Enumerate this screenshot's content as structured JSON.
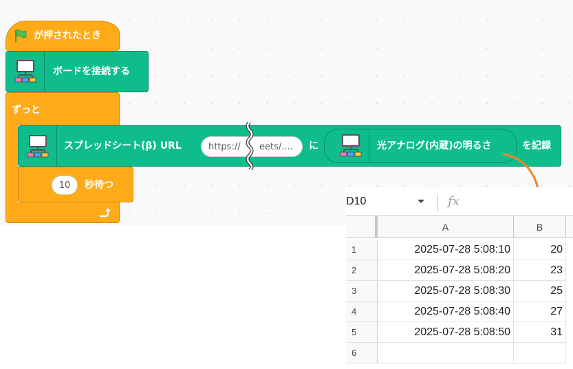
{
  "blocks": {
    "hat": {
      "label": "が押されたとき",
      "icon": "green-flag-icon"
    },
    "connect": {
      "label": "ボードを接続する",
      "icon": "board-icon"
    },
    "forever": {
      "label": "ずっと",
      "loop_icon": "loop-arrow-icon"
    },
    "record": {
      "label_before": "スプレッドシート(β) URL",
      "url_start": "https://",
      "url_end": "eets/....",
      "to_label": "に",
      "reporter_label": "光アナログ(内蔵)の明るさ",
      "action_label": "を記録"
    },
    "wait": {
      "value": "10",
      "label": "秒待つ"
    }
  },
  "spreadsheet": {
    "namebox": "D10",
    "fx": "fx",
    "columns": [
      "A",
      "B"
    ],
    "rows": [
      {
        "num": "1",
        "a": "2025-07-28 5:08:10",
        "b": "20"
      },
      {
        "num": "2",
        "a": "2025-07-28 5:08:20",
        "b": "23"
      },
      {
        "num": "3",
        "a": "2025-07-28 5:08:30",
        "b": "25"
      },
      {
        "num": "4",
        "a": "2025-07-28 5:08:40",
        "b": "27"
      },
      {
        "num": "5",
        "a": "2025-07-28 5:08:50",
        "b": "31"
      },
      {
        "num": "6",
        "a": "",
        "b": ""
      }
    ]
  },
  "colors": {
    "event_orange": "#ffab19",
    "extension_green": "#0fbd8c",
    "arrow": "#f0852c"
  }
}
